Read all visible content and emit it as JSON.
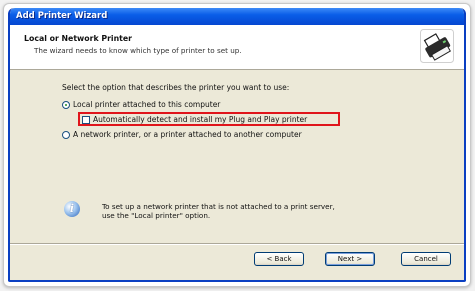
{
  "window": {
    "title": "Add Printer Wizard"
  },
  "header": {
    "title": "Local or Network Printer",
    "subtitle": "The wizard needs to know which type of printer to set up.",
    "icon": "printer-icon"
  },
  "main": {
    "prompt": "Select the option that describes the printer you want to use:",
    "options": {
      "local": {
        "label": "Local printer attached to this computer",
        "selected": true
      },
      "auto_detect": {
        "label": "Automatically detect and install my Plug and Play printer",
        "checked": false
      },
      "network": {
        "label": "A network printer, or a printer attached to another computer",
        "selected": false
      }
    },
    "info": {
      "icon": "info-icon",
      "line1": "To set up a network printer that is not attached to a print server,",
      "line2": "use the \"Local printer\" option."
    },
    "highlight_color": "#e0151b"
  },
  "buttons": {
    "back": "< Back",
    "next": "Next >",
    "cancel": "Cancel"
  }
}
